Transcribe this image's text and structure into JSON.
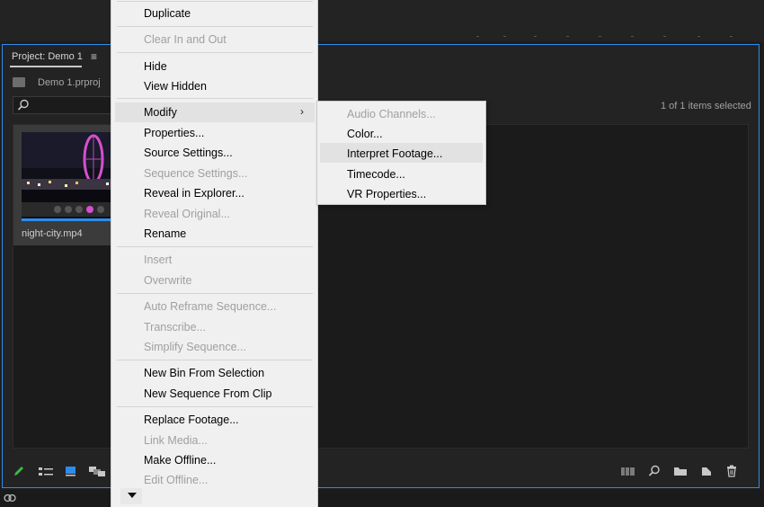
{
  "project_panel": {
    "tab_label": "Project: Demo 1",
    "menu_icon": "≡",
    "project_file": "Demo 1.prproj",
    "items_selected": "1 of 1 items selected",
    "clip": {
      "name": "night-city.mp4"
    }
  },
  "context_menu": {
    "items": [
      {
        "label": "Duplicate",
        "enabled": true
      },
      {
        "label": "Clear In and Out",
        "enabled": false
      },
      {
        "label": "Hide",
        "enabled": true
      },
      {
        "label": "View Hidden",
        "enabled": true
      },
      {
        "label": "Modify",
        "enabled": true,
        "submenu": true
      },
      {
        "label": "Properties...",
        "enabled": true
      },
      {
        "label": "Source Settings...",
        "enabled": true
      },
      {
        "label": "Sequence Settings...",
        "enabled": false
      },
      {
        "label": "Reveal in Explorer...",
        "enabled": true
      },
      {
        "label": "Reveal Original...",
        "enabled": false
      },
      {
        "label": "Rename",
        "enabled": true
      },
      {
        "label": "Insert",
        "enabled": false
      },
      {
        "label": "Overwrite",
        "enabled": false
      },
      {
        "label": "Auto Reframe Sequence...",
        "enabled": false
      },
      {
        "label": "Transcribe...",
        "enabled": false
      },
      {
        "label": "Simplify Sequence...",
        "enabled": false
      },
      {
        "label": "New Bin From Selection",
        "enabled": true
      },
      {
        "label": "New Sequence From Clip",
        "enabled": true
      },
      {
        "label": "Replace Footage...",
        "enabled": true
      },
      {
        "label": "Link Media...",
        "enabled": false
      },
      {
        "label": "Make Offline...",
        "enabled": true
      },
      {
        "label": "Edit Offline...",
        "enabled": false
      }
    ],
    "submenu_arrow": "›"
  },
  "submenu": {
    "items": [
      {
        "label": "Audio Channels...",
        "enabled": false
      },
      {
        "label": "Color...",
        "enabled": true
      },
      {
        "label": "Interpret Footage...",
        "enabled": true
      },
      {
        "label": "Timecode...",
        "enabled": true
      },
      {
        "label": "VR Properties...",
        "enabled": true
      }
    ]
  },
  "icons": {
    "search": "search-icon",
    "folder": "folder-icon",
    "pencil": "pencil-icon",
    "list_view": "list-view-icon",
    "icon_view": "icon-view-icon",
    "freeform_view": "freeform-view-icon",
    "automate": "automate-to-sequence-icon",
    "find": "find-icon",
    "new_bin": "new-bin-icon",
    "new_item": "new-item-icon",
    "clear": "trash-icon",
    "creative_cloud": "creative-cloud-icon"
  },
  "colors": {
    "panel_focus_border": "#2d8ceb",
    "menu_background": "#f0f0f0",
    "disabled_text": "#a0a0a0",
    "pencil_green": "#3dbb4a",
    "icon_view_blue": "#2d8ceb"
  }
}
